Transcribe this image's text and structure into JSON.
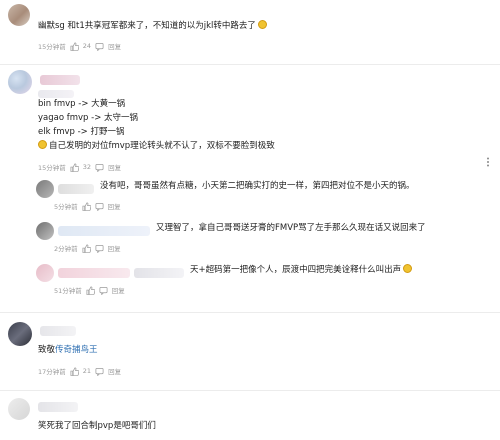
{
  "comments": [
    {
      "text_lines": [
        "幽默sg 和t1共享冠军都来了，不知道的以为jkl转中路去了"
      ],
      "time": "15分钟前",
      "likes": "24",
      "reply_label": "回复"
    },
    {
      "text_lines": [
        "bin fmvp -> 大黄一锅",
        "yagao fmvp -> 太守一锅",
        "elk fmvp -> 打野一锅",
        "自己发明的对位fmvp理论转头就不认了，双标不要脸到极致"
      ],
      "time": "15分钟前",
      "likes": "32",
      "reply_label": "回复"
    },
    {
      "text_lines": [
        "没有吧，哥哥虽然有点糖，小天第二把确实打的史一样，第四把对位不是小天的锅。"
      ],
      "time": "5分钟前",
      "likes": "",
      "reply_label": "回复"
    },
    {
      "text_lines": [
        "又理智了，拿自己哥哥送牙膏的FMVP骂了左手那么久现在话又说回来了"
      ],
      "time": "2分钟前",
      "likes": "",
      "reply_label": "回复"
    },
    {
      "text_lines": [
        "天+超码第一把像个人，辰渡中四把完美诠释什么叫出声"
      ],
      "time": "51分钟前",
      "likes": "",
      "reply_label": "回复"
    },
    {
      "text_prefix": "致敬",
      "text_link": "传奇捕鸟王",
      "time": "17分钟前",
      "likes": "21",
      "reply_label": "回复"
    },
    {
      "text_lines": [
        "笑死我了回合制pvp是吧哥们们"
      ],
      "time": "",
      "likes": "",
      "reply_label": ""
    }
  ],
  "icons": {
    "like": "thumb-up-icon",
    "reply": "reply-icon",
    "more": "more-vertical-icon",
    "emoji": "grin-emoji-icon"
  },
  "colors": {
    "link": "#2e6fb2",
    "meta": "#9a9a9a"
  }
}
